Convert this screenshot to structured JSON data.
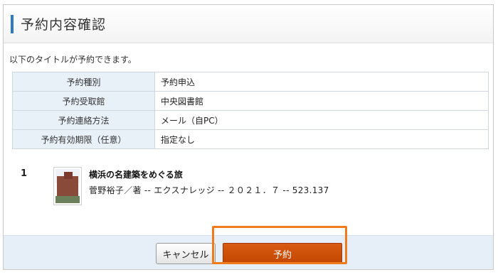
{
  "header": {
    "title": "予約内容確認"
  },
  "intro_text": "以下のタイトルが予約できます。",
  "details": [
    {
      "label": "予約種別",
      "value": "予約申込"
    },
    {
      "label": "予約受取館",
      "value": "中央図書館"
    },
    {
      "label": "予約連絡方法",
      "value": "メール（自PC）"
    },
    {
      "label": "予約有効期限（任意）",
      "value": "指定なし"
    }
  ],
  "result": {
    "number": "1",
    "title": "横浜の名建築をめぐる旅",
    "meta": "菅野裕子／著 -- エクスナレッジ -- ２０２１．７ -- 523.137"
  },
  "buttons": {
    "cancel": "キャンセル",
    "reserve": "予約"
  },
  "colors": {
    "accent_bar": "#2f78c4",
    "reserve_button": "#c24700",
    "highlight": "#f07b1d"
  }
}
